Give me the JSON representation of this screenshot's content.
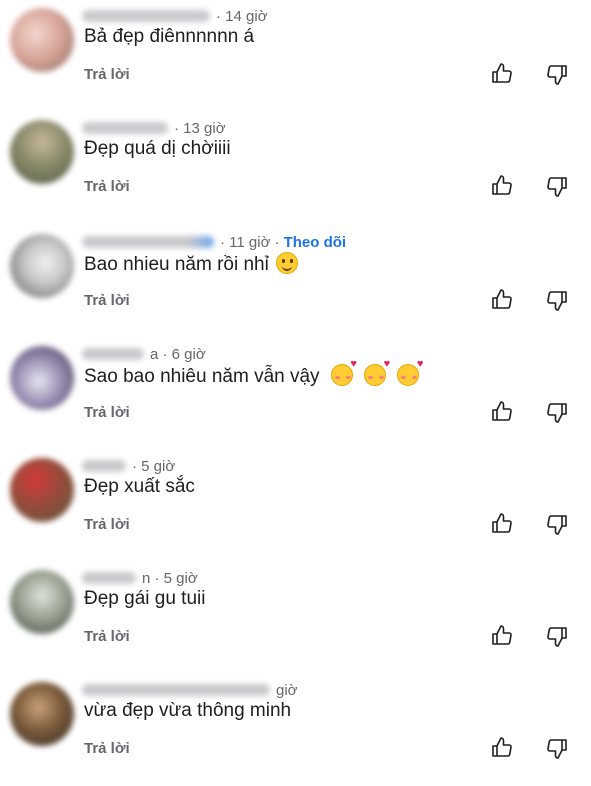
{
  "reply_label": "Trả lời",
  "colors": {
    "link": "#1b74e4",
    "meta": "#65676b",
    "text": "#1c1e21"
  },
  "icons": {
    "like": "thumbs-up-outline",
    "dislike": "thumbs-down-outline"
  },
  "comments": [
    {
      "time": "· 14 giờ",
      "text": "Bả đẹp điênnnnnn á"
    },
    {
      "time": "· 13 giờ",
      "text": "Đẹp quá dị chờiiii"
    },
    {
      "time": "· 11 giờ ·",
      "follow": "Theo dõi",
      "text": "Bao nhieu năm rồi nhỉ"
    },
    {
      "time": "a · 6 giờ",
      "text": "Sao bao nhiêu năm vẫn vậy"
    },
    {
      "time": "· 5 giờ",
      "text": "Đẹp xuất sắc"
    },
    {
      "time": "n · 5 giờ",
      "text": "Đẹp gái gu tuii"
    },
    {
      "time": "giờ",
      "text": "vừa đẹp vừa thông minh"
    }
  ]
}
